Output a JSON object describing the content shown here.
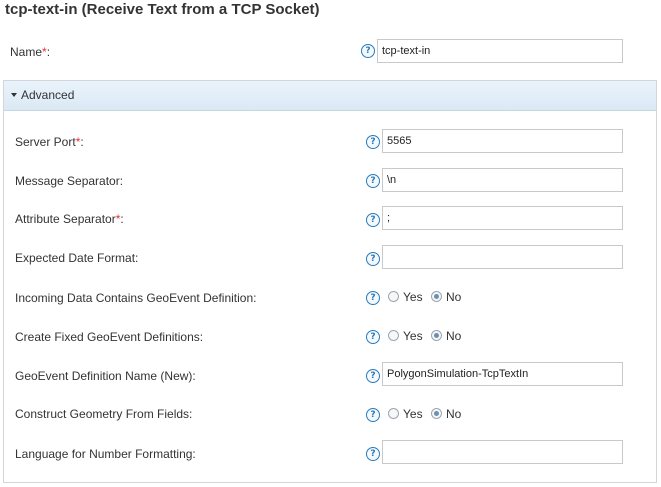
{
  "title": "tcp-text-in (Receive Text from a TCP Socket)",
  "name_field": {
    "label": "Name",
    "required_mark": "*",
    "colon": ":",
    "value": "tcp-text-in",
    "help": "?"
  },
  "advanced": {
    "label": "Advanced",
    "fields": {
      "server_port": {
        "label": "Server Port",
        "required_mark": "*",
        "colon": ":",
        "value": "5565",
        "help": "?"
      },
      "message_separator": {
        "label": "Message Separator:",
        "value": "\\n",
        "help": "?"
      },
      "attribute_separator": {
        "label": "Attribute Separator",
        "required_mark": "*",
        "colon": ":",
        "value": ";",
        "help": "?"
      },
      "expected_date_format": {
        "label": "Expected Date Format:",
        "value": "",
        "help": "?"
      },
      "incoming_geoevent_def": {
        "label": "Incoming Data Contains GeoEvent Definition:",
        "help": "?",
        "yes": "Yes",
        "no": "No",
        "selected": "No"
      },
      "create_fixed_defs": {
        "label": "Create Fixed GeoEvent Definitions:",
        "help": "?",
        "yes": "Yes",
        "no": "No",
        "selected": "No"
      },
      "geoevent_def_name": {
        "label": "GeoEvent Definition Name (New):",
        "value": "PolygonSimulation-TcpTextIn",
        "help": "?"
      },
      "construct_geometry": {
        "label": "Construct Geometry From Fields:",
        "help": "?",
        "yes": "Yes",
        "no": "No",
        "selected": "No"
      },
      "number_language": {
        "label": "Language for Number Formatting:",
        "value": "",
        "help": "?"
      }
    }
  }
}
